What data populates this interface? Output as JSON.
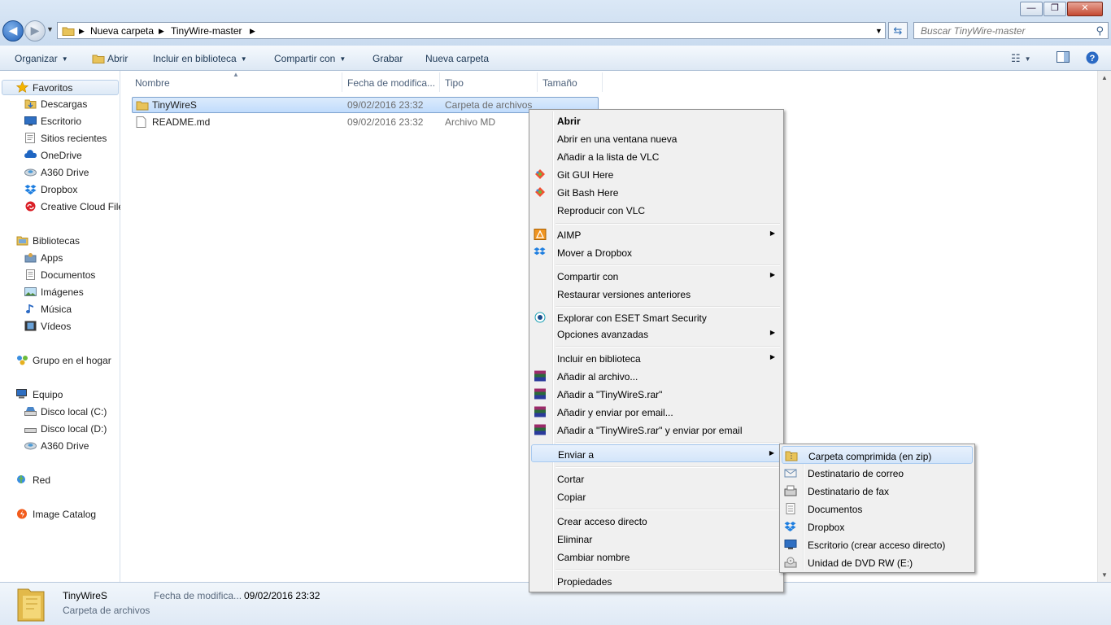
{
  "window": {
    "minimize_glyph": "—",
    "maximize_glyph": "❐",
    "close_glyph": "✕"
  },
  "address": {
    "crumbs": [
      "Nueva carpeta",
      "TinyWire-master"
    ],
    "search_placeholder": "Buscar TinyWire-master"
  },
  "toolbar": {
    "organize": "Organizar",
    "open": "Abrir",
    "include": "Incluir en biblioteca",
    "share": "Compartir con",
    "burn": "Grabar",
    "new_folder": "Nueva carpeta"
  },
  "sidebar": {
    "favorites": "Favoritos",
    "fav_items": [
      "Descargas",
      "Escritorio",
      "Sitios recientes",
      "OneDrive",
      "A360 Drive",
      "Dropbox",
      "Creative Cloud Files"
    ],
    "libraries": "Bibliotecas",
    "lib_items": [
      "Apps",
      "Documentos",
      "Imágenes",
      "Música",
      "Vídeos"
    ],
    "homegroup": "Grupo en el hogar",
    "computer": "Equipo",
    "comp_items": [
      "Disco local (C:)",
      "Disco local (D:)",
      "A360 Drive"
    ],
    "network": "Red",
    "image_catalog": "Image Catalog"
  },
  "columns": {
    "name": "Nombre",
    "date": "Fecha de modifica...",
    "type": "Tipo",
    "size": "Tamaño"
  },
  "files": [
    {
      "name": "TinyWireS",
      "date": "09/02/2016 23:32",
      "type": "Carpeta de archivos"
    },
    {
      "name": "README.md",
      "date": "09/02/2016 23:32",
      "type": "Archivo MD"
    }
  ],
  "context_menu": {
    "open": "Abrir",
    "open_new_window": "Abrir en una ventana nueva",
    "add_vlc_list": "Añadir a la lista de VLC",
    "git_gui": "Git GUI Here",
    "git_bash": "Git Bash Here",
    "play_vlc": "Reproducir con VLC",
    "aimp": "AIMP",
    "move_dropbox": "Mover a Dropbox",
    "share_with": "Compartir con",
    "restore_versions": "Restaurar versiones anteriores",
    "eset": "Explorar con ESET Smart Security",
    "advanced": "Opciones avanzadas",
    "include_library": "Incluir en biblioteca",
    "add_archive": "Añadir al archivo...",
    "add_rar": "Añadir a \"TinyWireS.rar\"",
    "add_email": "Añadir y enviar por email...",
    "add_rar_email": "Añadir a \"TinyWireS.rar\" y enviar por email",
    "send_to": "Enviar a",
    "cut": "Cortar",
    "copy": "Copiar",
    "create_shortcut": "Crear acceso directo",
    "delete": "Eliminar",
    "rename": "Cambiar nombre",
    "properties": "Propiedades"
  },
  "send_to_menu": {
    "zip": "Carpeta comprimida (en zip)",
    "mail": "Destinatario de correo",
    "fax": "Destinatario de fax",
    "documents": "Documentos",
    "dropbox": "Dropbox",
    "desktop": "Escritorio (crear acceso directo)",
    "dvd": "Unidad de DVD RW (E:)"
  },
  "details": {
    "name": "TinyWireS",
    "type": "Carpeta de archivos",
    "date_label": "Fecha de modifica...",
    "date_value": "09/02/2016 23:32"
  },
  "colors": {
    "selection": "#cce4ff",
    "menu_bg": "#f0f0f0",
    "accent": "#1f5fb8"
  }
}
